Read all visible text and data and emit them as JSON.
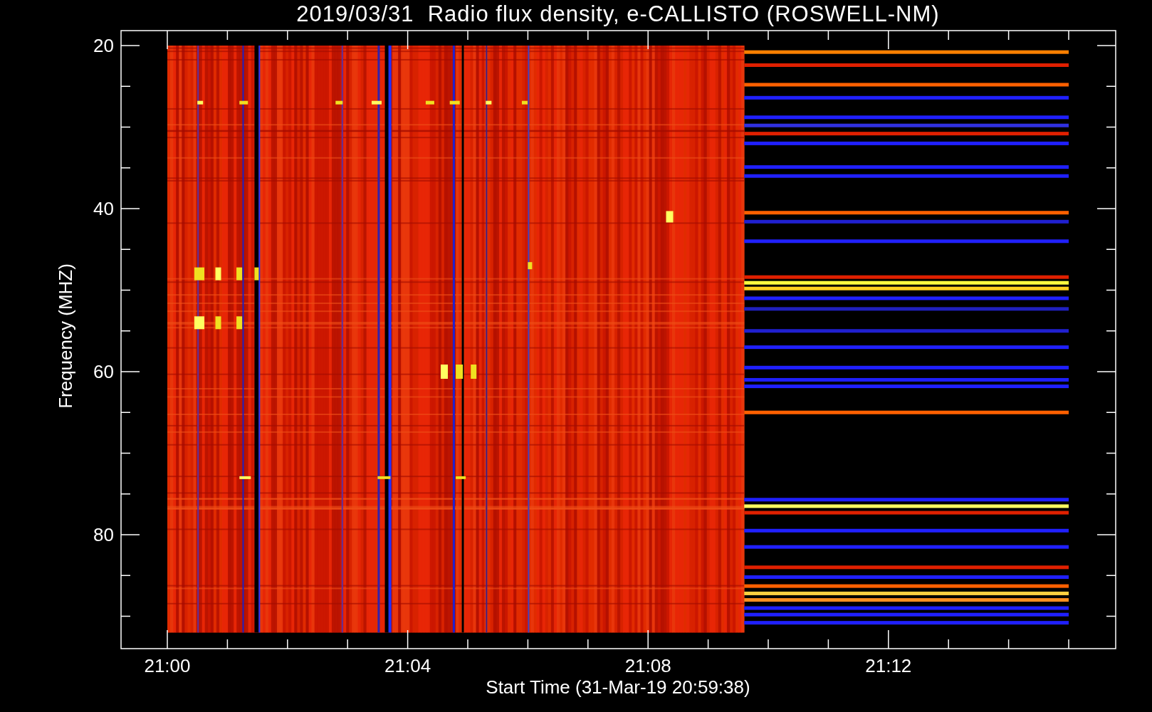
{
  "title": "2019/03/31  Radio flux density, e-CALLISTO (ROSWELL-NM)",
  "plot": {
    "ylabel": "Frequency (MHZ)",
    "xlabel": "Start Time (31-Mar-19 20:59:38)",
    "yticks": [
      "20",
      "40",
      "60",
      "80"
    ],
    "xticks": [
      "21:00",
      "21:04",
      "21:08",
      "21:12"
    ]
  }
}
